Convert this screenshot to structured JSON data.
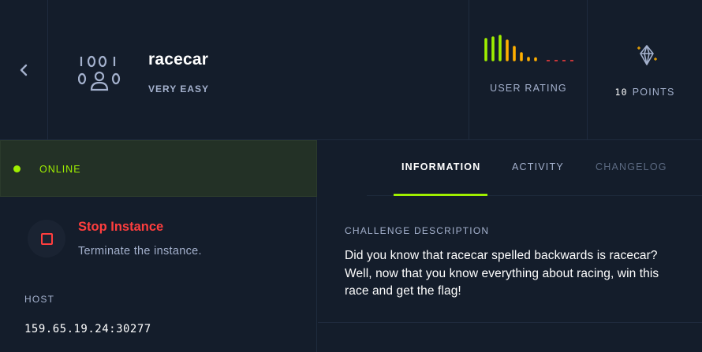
{
  "challenge": {
    "name": "racecar",
    "difficulty": "VERY EASY"
  },
  "rating": {
    "label": "USER RATING",
    "level": 0.5,
    "colors": [
      "#9fef00",
      "#9fef00",
      "#9fef00",
      "#ffaf00",
      "#ffaf00",
      "#ffaf00",
      "#ff3e3e"
    ]
  },
  "points": {
    "value": "10",
    "label": "POINTS"
  },
  "status": {
    "text": "ONLINE",
    "color": "#9fef00"
  },
  "stop": {
    "title": "Stop Instance",
    "subtitle": "Terminate the instance."
  },
  "host": {
    "label": "HOST",
    "value": "159.65.19.24:30277"
  },
  "tabs": {
    "information": "INFORMATION",
    "activity": "ACTIVITY",
    "changelog": "CHANGELOG"
  },
  "description": {
    "label": "CHALLENGE DESCRIPTION",
    "text": "Did you know that racecar spelled backwards is racecar? Well, now that you know everything about racing, win this race and get the flag!"
  },
  "icons": {
    "back": "chevron-left-icon",
    "category": "binary-user-icon",
    "points": "diamond-icon"
  }
}
